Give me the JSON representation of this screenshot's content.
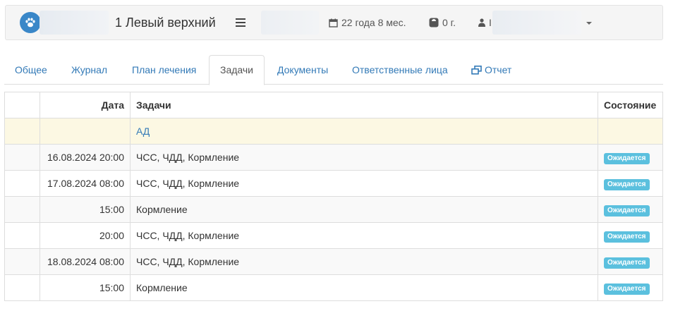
{
  "header": {
    "patient_name": "1 Левый верхний",
    "age": "22 года 8 мес.",
    "weight": "0 г.",
    "user_partial": "I"
  },
  "tabs": [
    {
      "label": "Общее",
      "active": false
    },
    {
      "label": "Журнал",
      "active": false
    },
    {
      "label": "План лечения",
      "active": false
    },
    {
      "label": "Задачи",
      "active": true
    },
    {
      "label": "Документы",
      "active": false
    },
    {
      "label": "Ответственные лица",
      "active": false
    },
    {
      "label": "Отчет",
      "active": false,
      "icon": "external-window-icon"
    }
  ],
  "table": {
    "headers": {
      "check": "",
      "date": "Дата",
      "tasks": "Задачи",
      "state": "Состояние"
    },
    "group": {
      "label": "АД"
    },
    "rows": [
      {
        "date": "16.08.2024 20:00",
        "tasks": "ЧСС, ЧДД, Кормление",
        "state": "Ожидается"
      },
      {
        "date": "17.08.2024 08:00",
        "tasks": "ЧСС, ЧДД, Кормление",
        "state": "Ожидается"
      },
      {
        "date": "15:00",
        "tasks": "Кормление",
        "state": "Ожидается"
      },
      {
        "date": "20:00",
        "tasks": "ЧСС, ЧДД, Кормление",
        "state": "Ожидается"
      },
      {
        "date": "18.08.2024 08:00",
        "tasks": "ЧСС, ЧДД, Кормление",
        "state": "Ожидается"
      },
      {
        "date": "15:00",
        "tasks": "Кормление",
        "state": "Ожидается"
      }
    ]
  },
  "colors": {
    "link": "#337ab7",
    "avatar": "#3a87c8",
    "badge_info": "#5bc0de",
    "group_row": "#fcf8e3"
  }
}
